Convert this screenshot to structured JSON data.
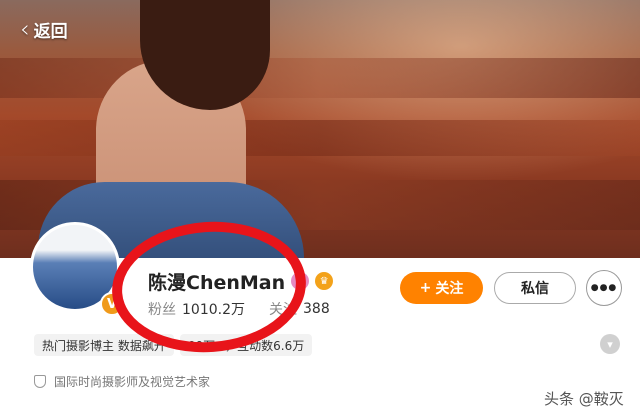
{
  "header": {
    "back_label": "返回",
    "back_icon": "chevron-left-icon"
  },
  "cover": {
    "accent": "#a4492a"
  },
  "profile": {
    "name": "陈漫ChenMan",
    "verified_icon": "verified-v-icon",
    "verified_mark": "V",
    "badges": [
      {
        "name": "vip-badge-icon",
        "glyph": "P",
        "color": "#e58ac2"
      },
      {
        "name": "crown-badge-icon",
        "glyph": "♛",
        "color": "#f3a21a"
      }
    ],
    "stats": {
      "fans_label": "粉丝",
      "fans_value": "1010.2万",
      "following_label": "关注",
      "following_value": "388"
    }
  },
  "actions": {
    "follow_label": "关注",
    "follow_icon": "plus-icon",
    "follow_color": "#ff8200",
    "message_label": "私信",
    "more_label": "●●●"
  },
  "tags": [
    "热门摄影博主 数据飙升",
    "00万+，互动数6.6万"
  ],
  "intro": {
    "text": "国际时尚摄影师及视觉艺术家",
    "icon": "shield-icon"
  },
  "annotation": {
    "color": "#e8141a"
  },
  "watermark": {
    "text": "头条 @鞍灭"
  }
}
